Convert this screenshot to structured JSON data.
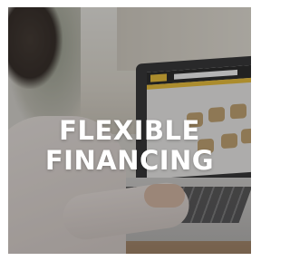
{
  "banner": {
    "headline_line1": "FLEXIBLE",
    "headline_line2": "FINANCING"
  }
}
